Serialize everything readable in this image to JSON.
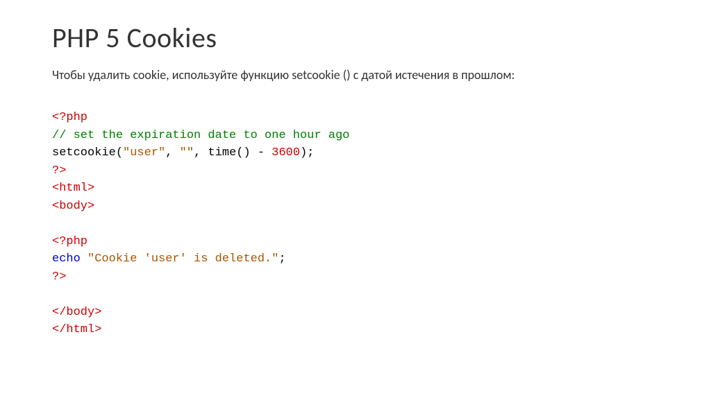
{
  "title": "PHP 5 Cookies",
  "description": "Чтобы удалить cookie, используйте функцию setcookie () с датой истечения в прошлом:",
  "code": {
    "l1": "<?php",
    "l2": "// set the expiration date to one hour ago",
    "l3a": "setcookie(",
    "l3b": "\"user\"",
    "l3c": ", ",
    "l3d": "\"\"",
    "l3e": ", time() - ",
    "l3f": "3600",
    "l3g": ");",
    "l4": "?>",
    "l5": "<html>",
    "l6": "<body>",
    "l7": "",
    "l8": "<?php",
    "l9a": "echo",
    "l9b": " ",
    "l9c": "\"Cookie 'user' is deleted.\"",
    "l9d": ";",
    "l10": "?>",
    "l11": "",
    "l12": "</body>",
    "l13": "</html>"
  }
}
